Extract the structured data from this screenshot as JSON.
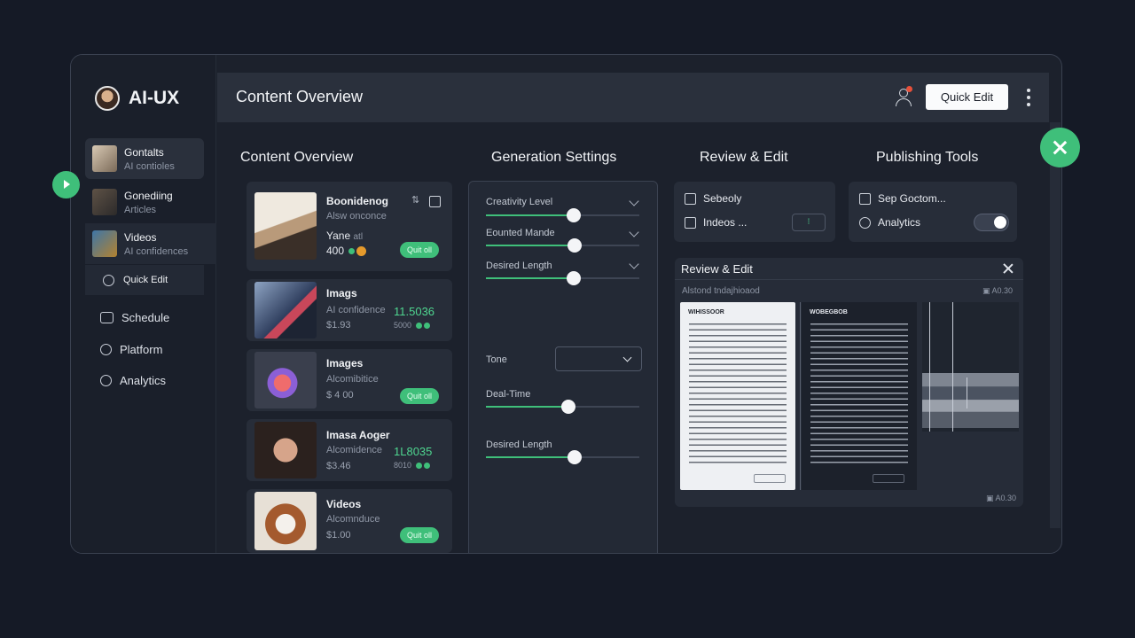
{
  "app": {
    "name": "AI-UX"
  },
  "sidebar": {
    "cards": [
      {
        "label": "Gontalts",
        "sub": "AI contioles"
      },
      {
        "label": "Gonediing",
        "sub": "Articles"
      },
      {
        "label": "Videos",
        "sub": "AI confidences"
      }
    ],
    "quick_edit": "Quick Edit",
    "items": [
      "Schedule",
      "Platform",
      "Analytics"
    ]
  },
  "topbar": {
    "title": "Content Overview",
    "quick_edit": "Quick Edit"
  },
  "columns": {
    "content": "Content Overview",
    "generation": "Generation Settings",
    "review": "Review & Edit",
    "publishing": "Publishing Tools"
  },
  "content_cards": [
    {
      "title": "Boonidenog",
      "sub": "Alsw onconce",
      "line3": "Yane",
      "line3b": "atl",
      "value": "400",
      "pill": "Quit oll"
    },
    {
      "title": "Imags",
      "sub": "AI confidence",
      "value": "$1.93",
      "green": "11.5036",
      "sub2": "5000"
    },
    {
      "title": "Images",
      "sub": "Alcomibitice",
      "value": "$ 4 00",
      "pill": "Quit oll"
    },
    {
      "title": "Imasa Aoger",
      "sub": "Alcomidence",
      "value": "$3.46",
      "green": "1L8035",
      "sub2": "8010"
    },
    {
      "title": "Videos",
      "sub": "Alcomnduce",
      "value": "$1.00",
      "pill": "Quit oll"
    }
  ],
  "settings": {
    "sliders": [
      {
        "label": "Creativity Level",
        "level": 0.57
      },
      {
        "label": "Eounted Mande",
        "level": 0.58
      },
      {
        "label": "Desired Length",
        "level": 0.57
      },
      {
        "label": "Deal-Time",
        "level": 0.54
      },
      {
        "label": "Desired Length",
        "level": 0.58
      }
    ],
    "tone_label": "Tone"
  },
  "review_tools": {
    "schedule": "Sebeoly",
    "indices": "Indeos ...",
    "btn": "⁝"
  },
  "publishing": {
    "sop": "Sep Goctom...",
    "analytics": "Analytics"
  },
  "review_panel": {
    "title": "Review & Edit",
    "subtitle": "Alstond tndajhioaod",
    "meta1": "A0.30",
    "meta2": "A0.30",
    "doc1_title": "WIHISSOOR",
    "doc2_title": "WOBEGBOB"
  }
}
